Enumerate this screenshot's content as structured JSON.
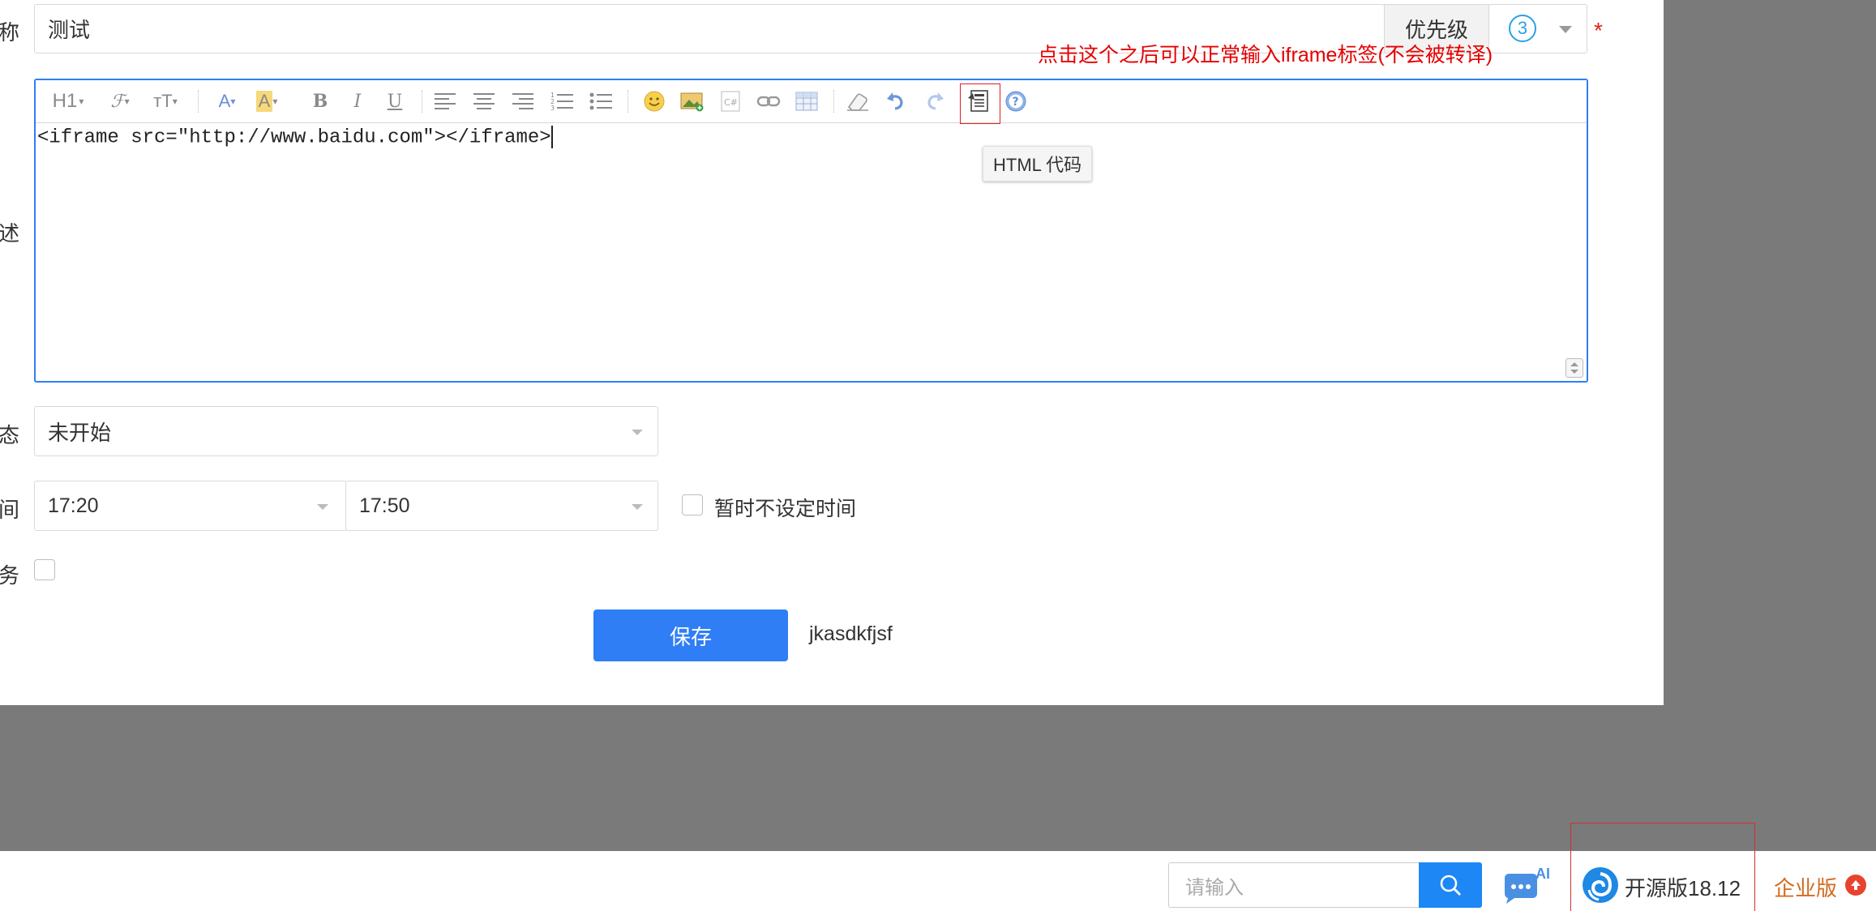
{
  "form": {
    "name_label_fragment": "称",
    "name_value": "测试",
    "priority_label": "优先级",
    "priority_value": "3",
    "annotation": "点击这个之后可以正常输入iframe标签(不会被转译)",
    "desc_label_fragment": "述",
    "status_label_fragment": "态",
    "status_value": "未开始",
    "time_label_fragment": "间",
    "start_time": "17:20",
    "end_time": "17:50",
    "no_time_label": "暂时不设定时间",
    "task_label_fragment": "务",
    "save_label": "保存",
    "extra_text": "jkasdkfjsf"
  },
  "editor": {
    "content": "<iframe src=\"http://www.baidu.com\"></iframe>",
    "tooltip": "HTML 代码",
    "heading_label": "H1",
    "font_family_label": "ℱ",
    "font_size_label": "тT",
    "bold_label": "B",
    "italic_label": "I",
    "underline_label": "U"
  },
  "footer": {
    "search_placeholder": "请输入",
    "ai_label": "AI",
    "version_label": "开源版18.12",
    "enterprise_label": "企业版"
  },
  "colors": {
    "primary": "#2f7ef5",
    "annotation_red": "#e60000",
    "enterprise_orange": "#d36a1e"
  }
}
